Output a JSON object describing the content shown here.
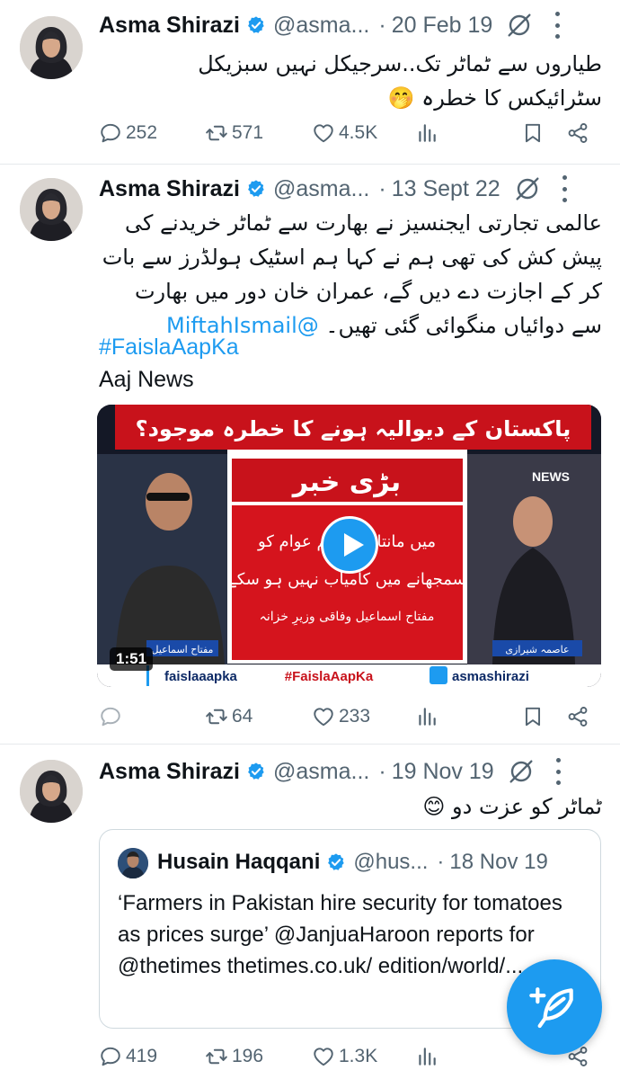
{
  "tweets": [
    {
      "name": "Asma Shirazi",
      "handle": "@asma...",
      "separator": "·",
      "date": "20 Feb 19",
      "text": "طیاروں سے ٹماٹر تک..سرجیکل نہیں سبزیکل سٹرائیکس کا خطرہ 🤭",
      "replies": "252",
      "reposts": "571",
      "likes": "4.5K"
    },
    {
      "name": "Asma Shirazi",
      "handle": "@asma...",
      "separator": "·",
      "date": "13 Sept 22",
      "text": "عالمی تجارتی ایجنسیز نے بھارت سے ٹماٹر خریدنے کی پیش کش کی تھی ہم نے کہا ہم اسٹیک ہولڈرز سے بات کر کے اجازت دے دیں گے، عمران خان دور میں بھارت سے دوائیاں منگوائی گئی تھیں۔",
      "mention": "@MiftahIsmail",
      "hashtag": "#FaislaAapKa",
      "source": "Aaj News",
      "video": {
        "duration": "1:51",
        "headline": "پاکستان کے دیوالیہ ہونے کا خطرہ موجود؟",
        "breaking": "بڑی خبر",
        "body_line1": "میں مانتا ہوں ہم عوام کو",
        "body_line2": "سمجھانے میں کامیاب نہیں ہو سکے",
        "attribution": "مفتاح اسماعیل وفاقی وزیرِ خزانہ",
        "left_label": "مفتاح اسماعیل",
        "right_label": "عاصمہ شیرازی",
        "channel": "NEWS",
        "ticker_left": "faislaaapka",
        "ticker_mid": "#FaislaAapKa",
        "ticker_right": "asmashirazi"
      },
      "reposts": "64",
      "likes": "233"
    },
    {
      "name": "Asma Shirazi",
      "handle": "@asma...",
      "separator": "·",
      "date": "19 Nov 19",
      "text": "ٹماٹر کو عزت دو 😊",
      "quote": {
        "name": "Husain Haqqani",
        "handle": "@hus...",
        "separator": "·",
        "date": "18 Nov 19",
        "text": "‘Farmers in Pakistan hire security for tomatoes as prices surge’ @JanjuaHaroon reports for @thetimes thetimes.co.uk/ edition/world/..."
      },
      "replies": "419",
      "reposts": "196",
      "likes": "1.3K"
    }
  ],
  "colors": {
    "accent": "#1d9bf0",
    "text": "#0f1419",
    "muted": "#536471",
    "divider": "#e6e9ec"
  },
  "icons": [
    "reply-icon",
    "repost-icon",
    "like-icon",
    "views-icon",
    "bookmark-icon",
    "share-icon",
    "grok-icon",
    "more-icon",
    "verified-icon",
    "compose-icon",
    "play-icon"
  ]
}
